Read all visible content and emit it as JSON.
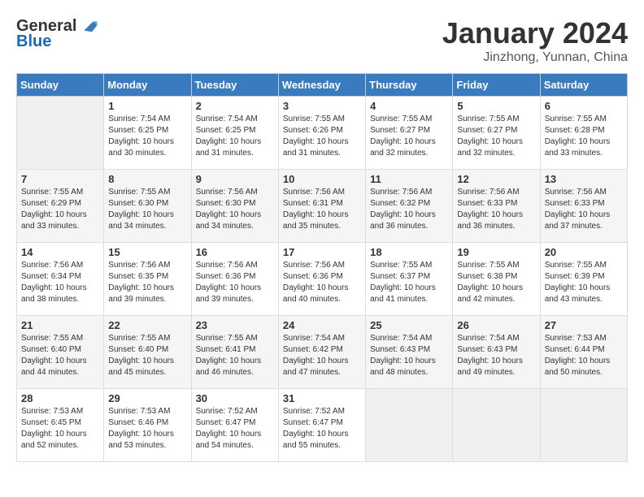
{
  "header": {
    "logo_general": "General",
    "logo_blue": "Blue",
    "month_title": "January 2024",
    "location": "Jinzhong, Yunnan, China"
  },
  "days_of_week": [
    "Sunday",
    "Monday",
    "Tuesday",
    "Wednesday",
    "Thursday",
    "Friday",
    "Saturday"
  ],
  "weeks": [
    [
      {
        "day": "",
        "info": ""
      },
      {
        "day": "1",
        "info": "Sunrise: 7:54 AM\nSunset: 6:25 PM\nDaylight: 10 hours\nand 30 minutes."
      },
      {
        "day": "2",
        "info": "Sunrise: 7:54 AM\nSunset: 6:25 PM\nDaylight: 10 hours\nand 31 minutes."
      },
      {
        "day": "3",
        "info": "Sunrise: 7:55 AM\nSunset: 6:26 PM\nDaylight: 10 hours\nand 31 minutes."
      },
      {
        "day": "4",
        "info": "Sunrise: 7:55 AM\nSunset: 6:27 PM\nDaylight: 10 hours\nand 32 minutes."
      },
      {
        "day": "5",
        "info": "Sunrise: 7:55 AM\nSunset: 6:27 PM\nDaylight: 10 hours\nand 32 minutes."
      },
      {
        "day": "6",
        "info": "Sunrise: 7:55 AM\nSunset: 6:28 PM\nDaylight: 10 hours\nand 33 minutes."
      }
    ],
    [
      {
        "day": "7",
        "info": "Sunrise: 7:55 AM\nSunset: 6:29 PM\nDaylight: 10 hours\nand 33 minutes."
      },
      {
        "day": "8",
        "info": "Sunrise: 7:55 AM\nSunset: 6:30 PM\nDaylight: 10 hours\nand 34 minutes."
      },
      {
        "day": "9",
        "info": "Sunrise: 7:56 AM\nSunset: 6:30 PM\nDaylight: 10 hours\nand 34 minutes."
      },
      {
        "day": "10",
        "info": "Sunrise: 7:56 AM\nSunset: 6:31 PM\nDaylight: 10 hours\nand 35 minutes."
      },
      {
        "day": "11",
        "info": "Sunrise: 7:56 AM\nSunset: 6:32 PM\nDaylight: 10 hours\nand 36 minutes."
      },
      {
        "day": "12",
        "info": "Sunrise: 7:56 AM\nSunset: 6:33 PM\nDaylight: 10 hours\nand 36 minutes."
      },
      {
        "day": "13",
        "info": "Sunrise: 7:56 AM\nSunset: 6:33 PM\nDaylight: 10 hours\nand 37 minutes."
      }
    ],
    [
      {
        "day": "14",
        "info": "Sunrise: 7:56 AM\nSunset: 6:34 PM\nDaylight: 10 hours\nand 38 minutes."
      },
      {
        "day": "15",
        "info": "Sunrise: 7:56 AM\nSunset: 6:35 PM\nDaylight: 10 hours\nand 39 minutes."
      },
      {
        "day": "16",
        "info": "Sunrise: 7:56 AM\nSunset: 6:36 PM\nDaylight: 10 hours\nand 39 minutes."
      },
      {
        "day": "17",
        "info": "Sunrise: 7:56 AM\nSunset: 6:36 PM\nDaylight: 10 hours\nand 40 minutes."
      },
      {
        "day": "18",
        "info": "Sunrise: 7:55 AM\nSunset: 6:37 PM\nDaylight: 10 hours\nand 41 minutes."
      },
      {
        "day": "19",
        "info": "Sunrise: 7:55 AM\nSunset: 6:38 PM\nDaylight: 10 hours\nand 42 minutes."
      },
      {
        "day": "20",
        "info": "Sunrise: 7:55 AM\nSunset: 6:39 PM\nDaylight: 10 hours\nand 43 minutes."
      }
    ],
    [
      {
        "day": "21",
        "info": "Sunrise: 7:55 AM\nSunset: 6:40 PM\nDaylight: 10 hours\nand 44 minutes."
      },
      {
        "day": "22",
        "info": "Sunrise: 7:55 AM\nSunset: 6:40 PM\nDaylight: 10 hours\nand 45 minutes."
      },
      {
        "day": "23",
        "info": "Sunrise: 7:55 AM\nSunset: 6:41 PM\nDaylight: 10 hours\nand 46 minutes."
      },
      {
        "day": "24",
        "info": "Sunrise: 7:54 AM\nSunset: 6:42 PM\nDaylight: 10 hours\nand 47 minutes."
      },
      {
        "day": "25",
        "info": "Sunrise: 7:54 AM\nSunset: 6:43 PM\nDaylight: 10 hours\nand 48 minutes."
      },
      {
        "day": "26",
        "info": "Sunrise: 7:54 AM\nSunset: 6:43 PM\nDaylight: 10 hours\nand 49 minutes."
      },
      {
        "day": "27",
        "info": "Sunrise: 7:53 AM\nSunset: 6:44 PM\nDaylight: 10 hours\nand 50 minutes."
      }
    ],
    [
      {
        "day": "28",
        "info": "Sunrise: 7:53 AM\nSunset: 6:45 PM\nDaylight: 10 hours\nand 52 minutes."
      },
      {
        "day": "29",
        "info": "Sunrise: 7:53 AM\nSunset: 6:46 PM\nDaylight: 10 hours\nand 53 minutes."
      },
      {
        "day": "30",
        "info": "Sunrise: 7:52 AM\nSunset: 6:47 PM\nDaylight: 10 hours\nand 54 minutes."
      },
      {
        "day": "31",
        "info": "Sunrise: 7:52 AM\nSunset: 6:47 PM\nDaylight: 10 hours\nand 55 minutes."
      },
      {
        "day": "",
        "info": ""
      },
      {
        "day": "",
        "info": ""
      },
      {
        "day": "",
        "info": ""
      }
    ]
  ]
}
